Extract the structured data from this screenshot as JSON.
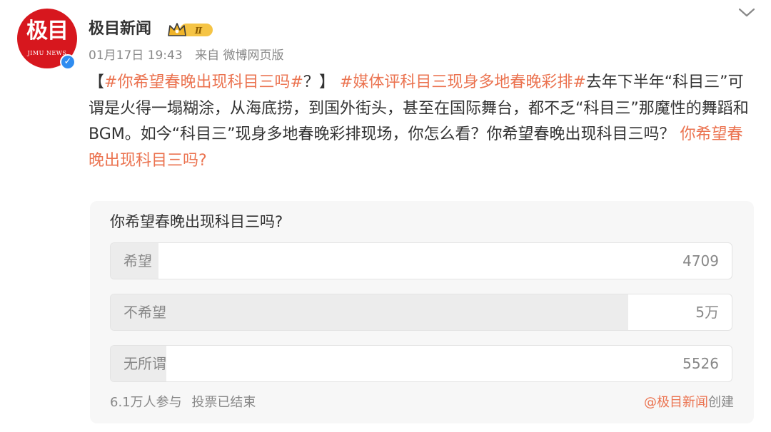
{
  "account": {
    "name": "极目新闻",
    "avatar_text": "极目",
    "avatar_subtext": "JIMU NEWS",
    "verified_icon": "verified-check-icon",
    "vip_badge": "Ⅱ",
    "timestamp": "01月17日 19:43",
    "source": "来自 微博网页版"
  },
  "post": {
    "bracket_open": "【",
    "tag1": "#你希望春晚出现科目三吗#",
    "bracket_close": "？】",
    "tag2": "#媒体评科目三现身多地春晚彩排#",
    "body": "去年下半年“科目三”可谓是火得一塌糊涂，从海底捞，到国外街头，甚至在国际舞台，都不乏“科目三”那魔性的舞蹈和BGM。如今“科目三”现身多地春晚彩排现场，你怎么看？你希望春晚出现科目三吗？",
    "trailing_link": "你希望春晚出现科目三吗?"
  },
  "poll": {
    "question": "你希望春晚出现科目三吗?",
    "options": [
      {
        "label": "希望",
        "count": "4709",
        "share": 0.077
      },
      {
        "label": "不希望",
        "count": "5万",
        "share": 0.833
      },
      {
        "label": "无所谓",
        "count": "5526",
        "share": 0.09
      }
    ],
    "participants": "6.1万人参与",
    "status": "投票已结束",
    "creator": "@极目新闻",
    "created_label": "创建"
  },
  "colors": {
    "accent": "#eb7350",
    "brand_red": "#d7171e",
    "verified_blue": "#2f8cf0",
    "vip_gold": "#f5c445"
  },
  "icons": {
    "menu": "chevron-down-icon",
    "vip": "crown-badge-icon"
  }
}
